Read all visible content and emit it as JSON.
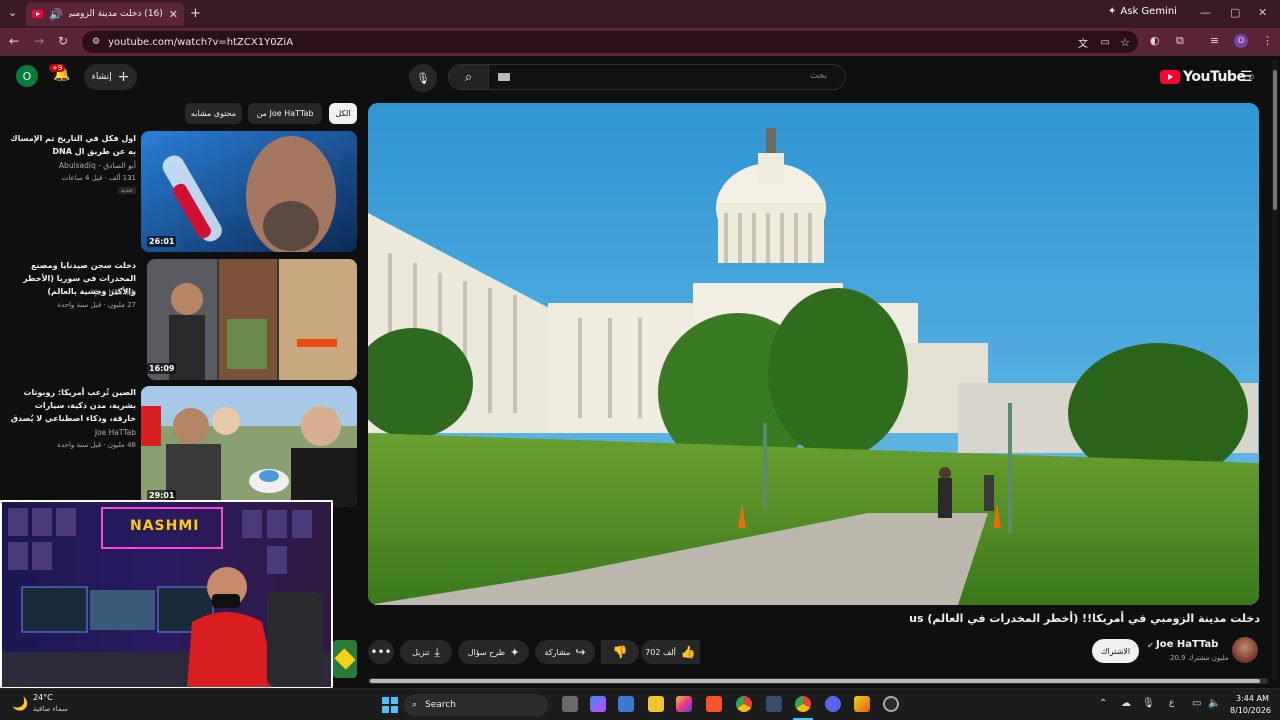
{
  "browser": {
    "tab_title": "(16) دخلت مدينة الزومبي في",
    "url": "youtube.com/watch?v=htZCX1Y0ZiA",
    "ask_gemini": "Ask Gemini",
    "profile_initial": "O"
  },
  "header": {
    "logo_text": "YouTube",
    "logo_country": "JO",
    "search_placeholder": "بحث",
    "create_label": "إنشاء",
    "notif_count": "+9",
    "avatar_initial": "O"
  },
  "chips": [
    {
      "label": "الكل"
    },
    {
      "label": "من Joe HaTTab"
    },
    {
      "label": "محتوى مشابه"
    }
  ],
  "video": {
    "title": "دخلت مدينة الزومبي في أمريكا!! (أخطر المخدرات في العالم) us",
    "channel": "Joe HaTTab",
    "subscribers": "20.9 مليون مشترك",
    "subscribe_label": "الاشتراك",
    "likes": "702 ألف",
    "share_label": "مشاركة",
    "ask_label": "طرح سؤال",
    "download_label": "تنزيل"
  },
  "recommendations": [
    {
      "title": "اول فكل في التاريخ تم الإمساك به عن طريق ال DNA",
      "channel": "أبو الصادق - Abulsadiq",
      "meta": "131 ألف · قبل 4 ساعات",
      "badge": "جديد",
      "duration": "26:01"
    },
    {
      "title": "دخلت سجن صيدنايا ومصنع المخدرات في سوريا (الأخطر والأكثر وحشية بالعالم)",
      "channel": "Joe HaTTab",
      "meta": "27 مليون · قبل سنة واحدة",
      "duration": "16:09"
    },
    {
      "title": "الصين تُرعب أمريكا: روبوتات بشرية، مدن ذكية، سيارات خارقة، وذكاء اصطناعي لا يُصدق",
      "channel": "Joe HaTTab",
      "meta": "48 مليون · قبل سنة واحدة",
      "duration": "29:01"
    }
  ],
  "webcam": {
    "neon_text": "NASHMI"
  },
  "taskbar": {
    "temperature": "24°C",
    "weather": "سماء صافية",
    "search_label": "Search",
    "time": "3:44 AM",
    "date": "8/10/2026",
    "lang": "ع"
  }
}
